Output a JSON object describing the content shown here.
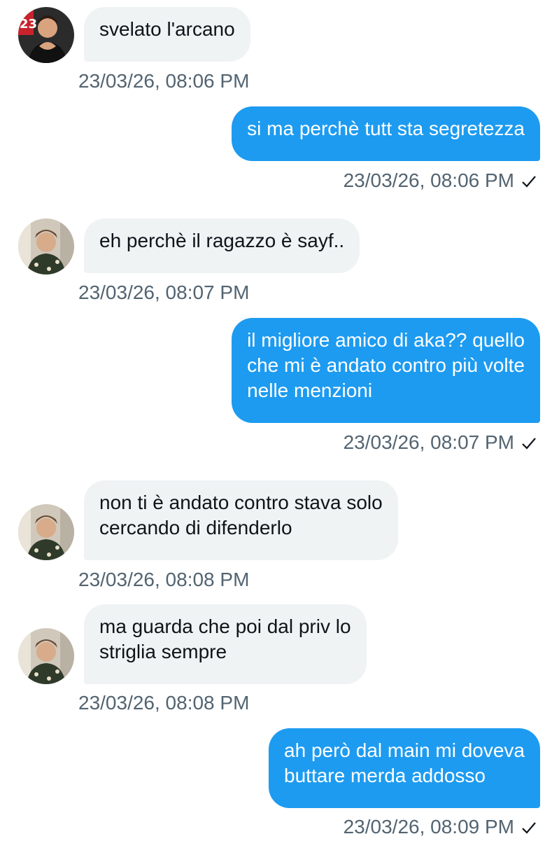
{
  "colors": {
    "incoming_bubble": "#eff3f4",
    "outgoing_bubble": "#1d9bf0",
    "timestamp": "#536471",
    "text_dark": "#0f1419",
    "text_light": "#ffffff"
  },
  "messages": [
    {
      "direction": "incoming",
      "text": "svelato l'arcano",
      "time": "23/03/26, 08:06 PM"
    },
    {
      "direction": "outgoing",
      "text": "si ma perchè tutt sta segretezza",
      "time": "23/03/26, 08:06 PM",
      "status_icon": "checkmark-icon"
    },
    {
      "direction": "incoming",
      "text": "eh perchè il ragazzo è sayf..",
      "time": "23/03/26, 08:07 PM"
    },
    {
      "direction": "outgoing",
      "text": "il migliore amico di aka?? quello\nche mi è andato contro più volte\nnelle menzioni",
      "time": "23/03/26, 08:07 PM",
      "status_icon": "checkmark-icon"
    },
    {
      "direction": "incoming",
      "text": "non ti è andato contro stava solo\ncercando di difenderlo",
      "time": "23/03/26, 08:08 PM"
    },
    {
      "direction": "incoming",
      "text": "ma guarda che poi dal priv lo\nstriglia sempre",
      "time": "23/03/26, 08:08 PM"
    },
    {
      "direction": "outgoing",
      "text": "ah però dal main mi doveva\nbuttare merda addosso",
      "time": "23/03/26, 08:09 PM",
      "status_icon": "checkmark-icon"
    }
  ]
}
